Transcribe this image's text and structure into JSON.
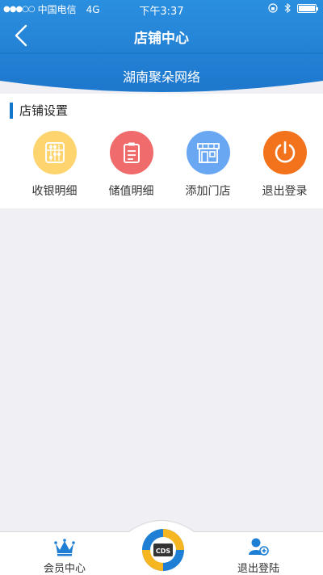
{
  "status_bar": {
    "signal": "●●●○○",
    "carrier": "中国电信",
    "network": "4G",
    "time": "下午3:37"
  },
  "nav": {
    "title": "店铺中心"
  },
  "store": {
    "name": "湖南聚朵网络"
  },
  "section": {
    "title": "店铺设置"
  },
  "actions": [
    {
      "label": "收银明细",
      "icon": "abacus-icon",
      "color": "#fdd46e"
    },
    {
      "label": "储值明细",
      "icon": "clipboard-icon",
      "color": "#f06b6b"
    },
    {
      "label": "添加门店",
      "icon": "storefront-icon",
      "color": "#6aa7f2"
    },
    {
      "label": "退出登录",
      "icon": "power-icon",
      "color": "#f2731c"
    }
  ],
  "tabbar": {
    "left_label": "会员中心",
    "right_label": "退出登陆",
    "center_logo": "CDS"
  },
  "colors": {
    "primary_blue": "#1f7fd4",
    "accent_bar": "#1577cc",
    "page_bg": "#efeff4"
  }
}
